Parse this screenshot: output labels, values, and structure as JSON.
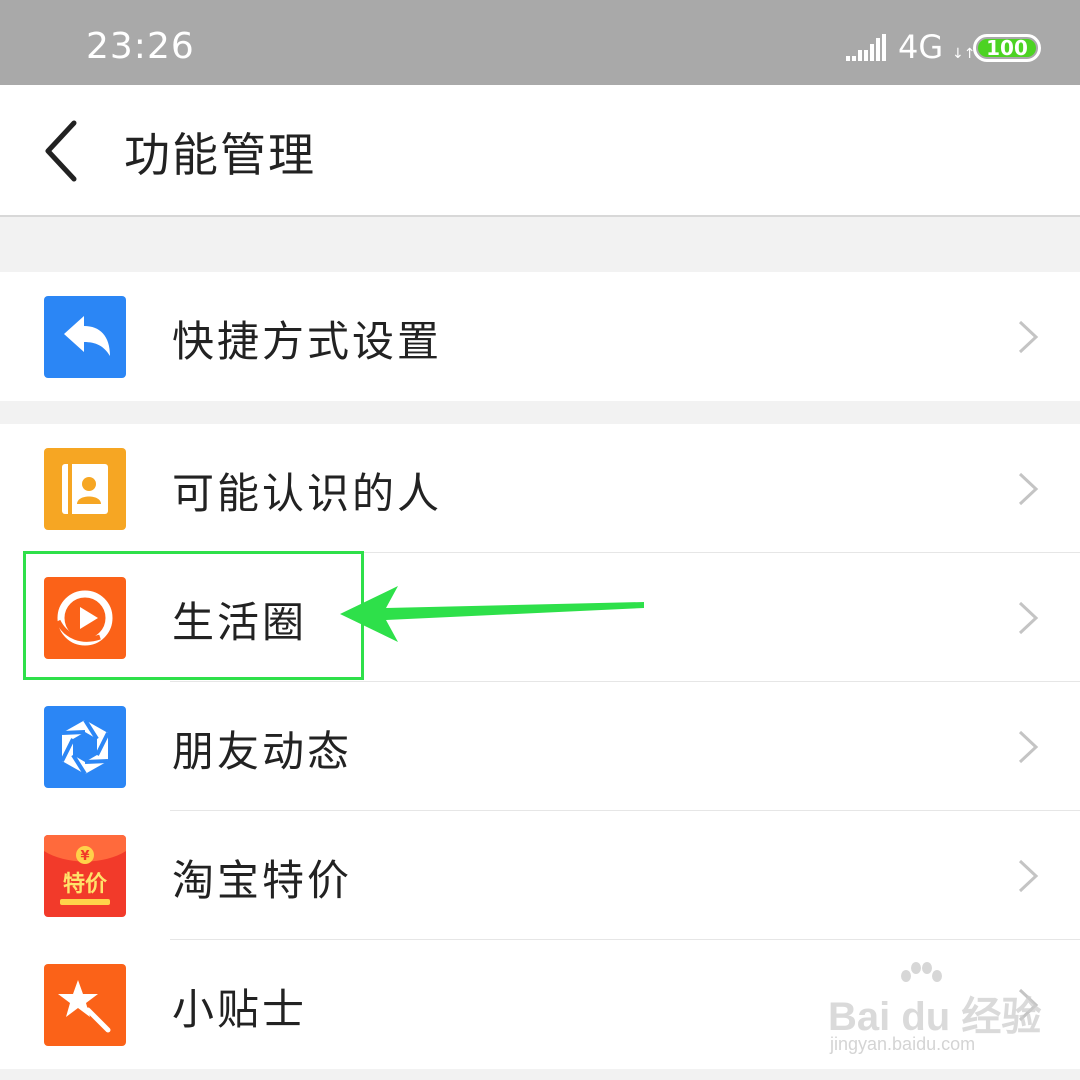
{
  "status_bar": {
    "time": "23:26",
    "network": "4G",
    "network_arrows": "↓↑",
    "battery": "100",
    "battery_color": "#4cd322"
  },
  "header": {
    "title": "功能管理",
    "back_icon": "chevron-left-icon"
  },
  "items": [
    {
      "label": "快捷方式设置",
      "icon": "reply-arrow-icon",
      "icon_bg": "#2b86f5"
    },
    {
      "label": "可能认识的人",
      "icon": "contact-book-icon",
      "icon_bg": "#f6a623"
    },
    {
      "label": "生活圈",
      "icon": "play-circle-icon",
      "icon_bg": "#fb6218"
    },
    {
      "label": "朋友动态",
      "icon": "aperture-icon",
      "icon_bg": "#2b86f5"
    },
    {
      "label": "淘宝特价",
      "icon": "red-packet-icon",
      "icon_bg": "#f23a2a",
      "icon_text": "特价",
      "icon_symbol": "¥"
    },
    {
      "label": "小贴士",
      "icon": "star-wand-icon",
      "icon_bg": "#fb6218"
    }
  ],
  "annotation": {
    "highlight_color": "#2ee04a",
    "target": "生活圈"
  },
  "watermark": {
    "text": "Bai du 经验",
    "url": "jingyan.baidu.com"
  }
}
